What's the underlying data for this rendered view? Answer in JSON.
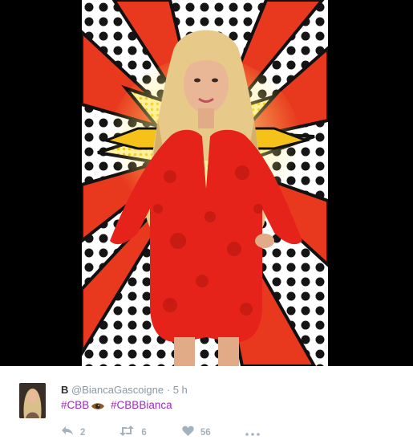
{
  "media": {
    "photo_alt": "CBB promotional photo of Bianca Gascoigne"
  },
  "tweet": {
    "display_name": "B",
    "handle": "@BiancaGascoigne",
    "separator": "·",
    "time": "5 h",
    "hashtags": [
      "#CBB",
      "#CBBBianca"
    ],
    "actions": {
      "reply_count": "2",
      "retweet_count": "6",
      "like_count": "56"
    }
  },
  "colors": {
    "hashtag": "#9b2cb9",
    "action_gray": "#a3b2be",
    "name": "#292f33",
    "meta": "#8899a6"
  },
  "icons": {
    "reply": "reply-icon",
    "retweet": "retweet-icon",
    "like": "heart-icon",
    "more": "more-icon",
    "emoji": "eye-emoji-icon"
  }
}
